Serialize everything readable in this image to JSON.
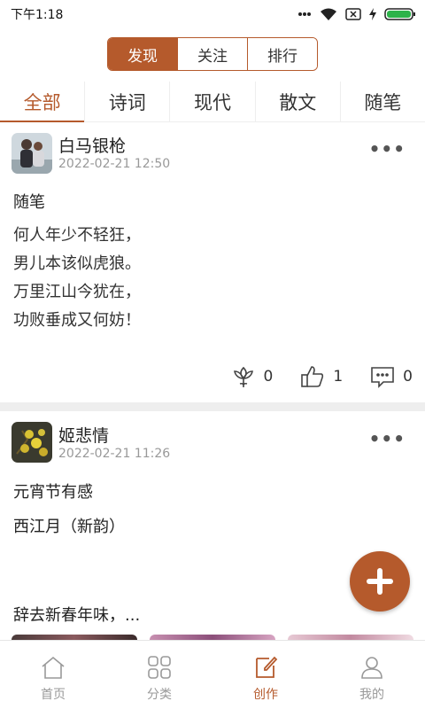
{
  "status_bar": {
    "time": "下午1:18"
  },
  "segmented": [
    {
      "label": "发现",
      "active": true
    },
    {
      "label": "关注",
      "active": false
    },
    {
      "label": "排行",
      "active": false
    }
  ],
  "categories": [
    {
      "label": "全部",
      "active": true
    },
    {
      "label": "诗词",
      "active": false
    },
    {
      "label": "现代",
      "active": false
    },
    {
      "label": "散文",
      "active": false
    },
    {
      "label": "随笔",
      "active": false
    }
  ],
  "posts": [
    {
      "author": "白马银枪",
      "date": "2022-02-21 12:50",
      "title": "随笔",
      "body": [
        "何人年少不轻狂，",
        "男儿本该似虎狼。",
        "万里江山今犹在，",
        "功败垂成又何妨！"
      ],
      "flower_count": "0",
      "like_count": "1",
      "comment_count": "0"
    },
    {
      "author": "姬悲情",
      "date": "2022-02-21 11:26",
      "title": "元宵节有感",
      "subtitle": "西江月（新韵）",
      "excerpt": "辞去新春年味，..."
    }
  ],
  "more_label": "•••",
  "nav": [
    {
      "label": "首页",
      "icon": "home-icon",
      "active": false
    },
    {
      "label": "分类",
      "icon": "grid-icon",
      "active": false
    },
    {
      "label": "创作",
      "icon": "edit-icon",
      "active": true
    },
    {
      "label": "我的",
      "icon": "user-icon",
      "active": false
    }
  ],
  "colors": {
    "accent": "#b55a2c",
    "battery": "#2db34a"
  }
}
